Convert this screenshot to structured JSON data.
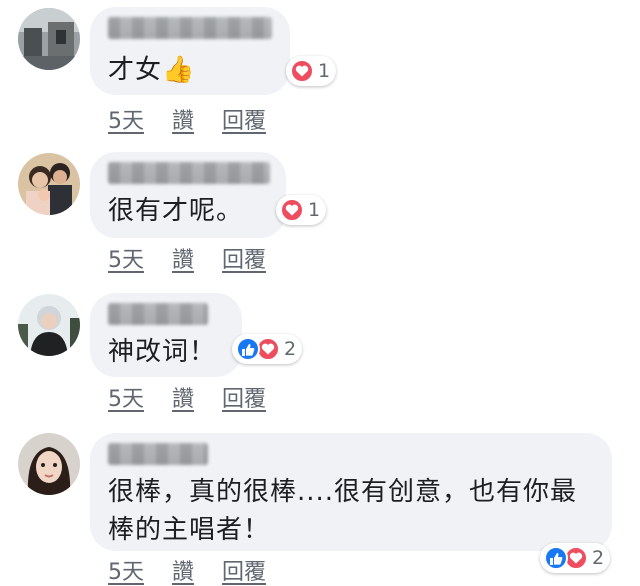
{
  "comments": [
    {
      "text": "才女👍",
      "reaction_count": "1",
      "time": "5天",
      "like": "讚",
      "reply": "回覆"
    },
    {
      "text": "很有才呢。",
      "reaction_count": "1",
      "time": "5天",
      "like": "讚",
      "reply": "回覆"
    },
    {
      "text": "神改词！",
      "reaction_count": "2",
      "time": "5天",
      "like": "讚",
      "reply": "回覆"
    },
    {
      "text": "很棒，真的很棒....很有创意，也有你最\n棒的主唱者！",
      "reaction_count": "2",
      "time": "5天",
      "like": "讚",
      "reply": "回覆"
    }
  ],
  "icons": {
    "heart": "heart-icon",
    "like": "thumbs-up-icon",
    "heart_color": "#ee4d5f",
    "like_color": "#1877f2"
  }
}
